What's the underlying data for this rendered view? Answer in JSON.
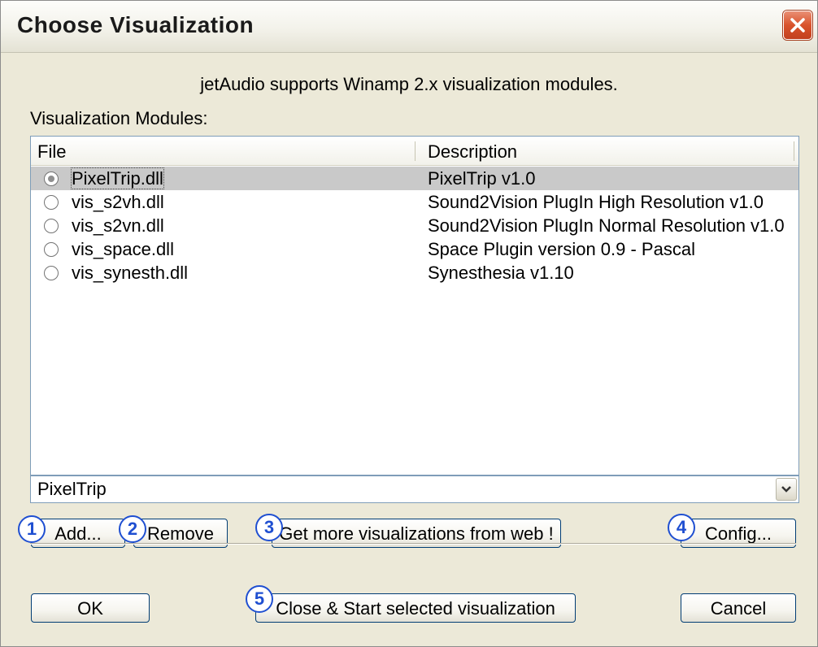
{
  "window": {
    "title": "Choose Visualization"
  },
  "info_text": "jetAudio supports Winamp 2.x visualization modules.",
  "modules_label": "Visualization Modules:",
  "list": {
    "columns": {
      "file": "File",
      "description": "Description"
    },
    "rows": [
      {
        "file": "PixelTrip.dll",
        "description": "PixelTrip v1.0",
        "selected": true
      },
      {
        "file": "vis_s2vh.dll",
        "description": "Sound2Vision PlugIn High Resolution v1.0",
        "selected": false
      },
      {
        "file": "vis_s2vn.dll",
        "description": "Sound2Vision PlugIn Normal Resolution v1.0",
        "selected": false
      },
      {
        "file": "vis_space.dll",
        "description": "Space Plugin version 0.9 -  Pascal",
        "selected": false
      },
      {
        "file": "vis_synesth.dll",
        "description": "Synesthesia v1.10",
        "selected": false
      }
    ]
  },
  "combo": {
    "value": "PixelTrip"
  },
  "buttons": {
    "add": "Add...",
    "remove": "Remove",
    "get_more": "Get more visualizations from web !",
    "config": "Config...",
    "ok": "OK",
    "close_start": "Close & Start selected visualization",
    "cancel": "Cancel"
  },
  "badges": [
    "1",
    "2",
    "3",
    "4",
    "5"
  ],
  "icons": {
    "close": "close-icon",
    "dropdown": "chevron-down-icon",
    "radio": "radio-icon"
  },
  "colors": {
    "close_button": "#d9532c",
    "badge": "#1f4fd1",
    "selection": "#c9c9c9"
  }
}
